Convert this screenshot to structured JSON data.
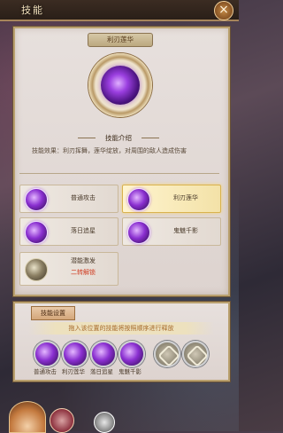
{
  "window": {
    "title": "技能",
    "close_label": "×"
  },
  "detail": {
    "skill_name": "利刃莲华",
    "intro_label": "技能介绍",
    "effect_text": "技能效果：利刃挥舞，莲华绽放，对周围的敌人造成伤害"
  },
  "skills": [
    {
      "name": "普通攻击",
      "sub": "",
      "selected": false,
      "icon": "purple-slash-icon"
    },
    {
      "name": "利刃莲华",
      "sub": "",
      "selected": true,
      "icon": "purple-lotus-icon"
    },
    {
      "name": "落日追星",
      "sub": "",
      "selected": false,
      "icon": "purple-star-icon"
    },
    {
      "name": "鬼魅千影",
      "sub": "",
      "selected": false,
      "icon": "purple-shadow-icon"
    },
    {
      "name": "潜能激发",
      "sub": "二转解锁",
      "selected": false,
      "icon": "locked-potential-icon"
    }
  ],
  "settings": {
    "tab_label": "技能设置",
    "hint": "拖入该位置的技能将按照顺序进行释放",
    "slots": [
      {
        "label": "普通攻击",
        "empty": false
      },
      {
        "label": "利刃莲华",
        "empty": false
      },
      {
        "label": "落日追星",
        "empty": false
      },
      {
        "label": "鬼魅千影",
        "empty": false
      },
      {
        "label": "",
        "empty": true
      },
      {
        "label": "",
        "empty": true
      }
    ]
  },
  "colors": {
    "accent": "#d9b24e",
    "locked_text": "#d03a1f",
    "frame": "#b9a06e"
  }
}
